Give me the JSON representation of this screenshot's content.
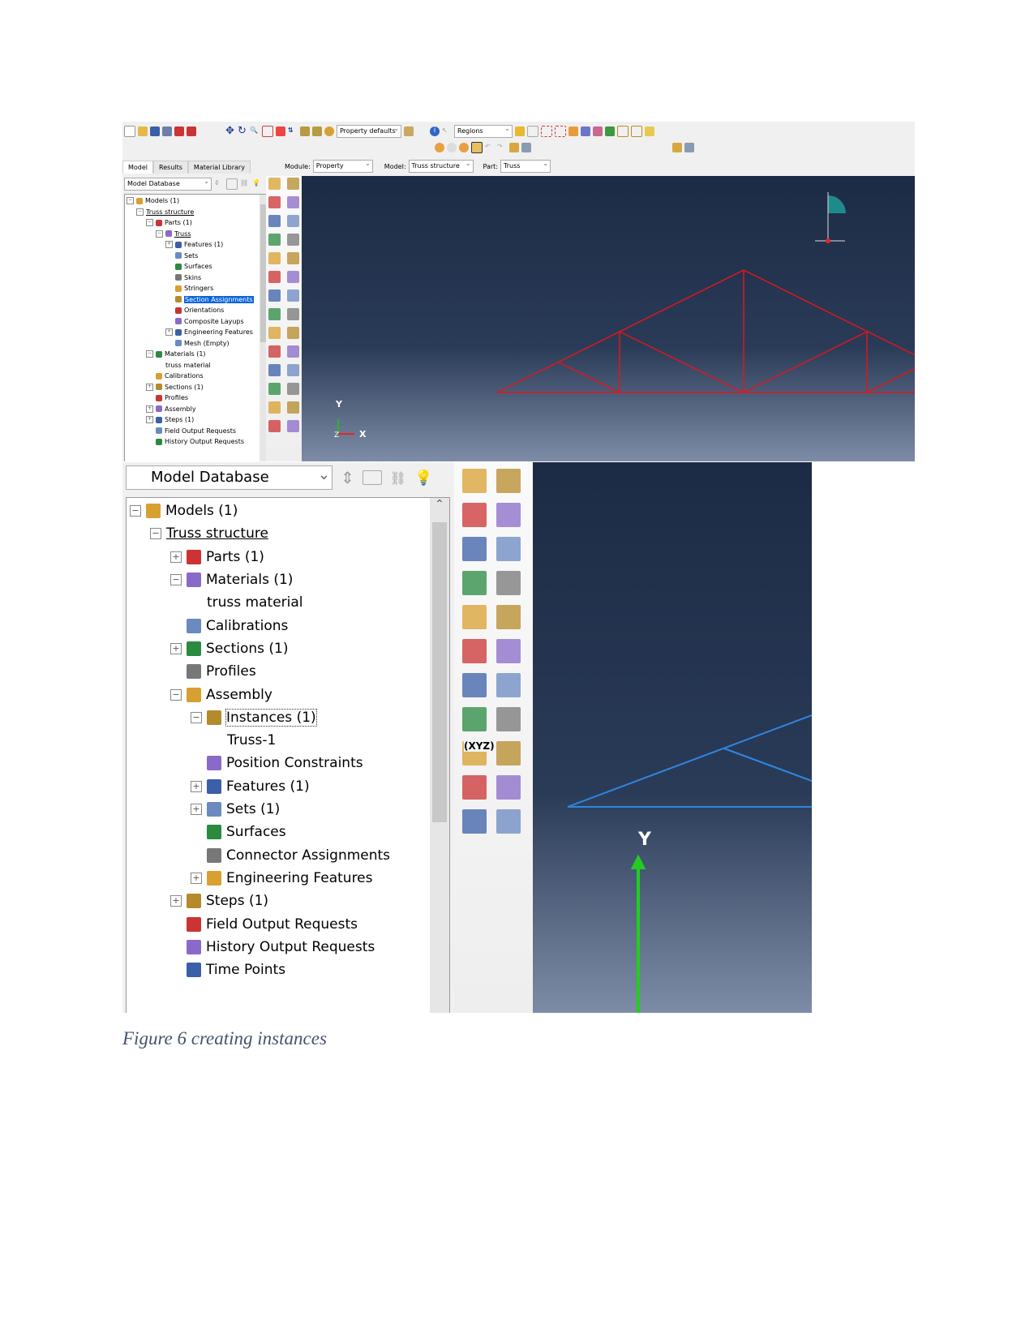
{
  "screenshot1": {
    "toolbar": {
      "render_style": "Property defaults",
      "selection_filter": "Regions"
    },
    "context": {
      "module_label": "Module:",
      "module": "Property",
      "model_label": "Model:",
      "model": "Truss structure",
      "part_label": "Part:",
      "part": "Truss"
    },
    "tabs": [
      "Model",
      "Results",
      "Material Library"
    ],
    "tree_selector": "Model Database",
    "tree": [
      {
        "label": "Models (1)",
        "level": 0,
        "exp": "−"
      },
      {
        "label": "Truss structure",
        "level": 1,
        "exp": "−",
        "style": "ul"
      },
      {
        "label": "Parts (1)",
        "level": 2,
        "exp": "−"
      },
      {
        "label": "Truss",
        "level": 3,
        "exp": "−",
        "style": "ul"
      },
      {
        "label": "Features (1)",
        "level": 4,
        "exp": "+"
      },
      {
        "label": "Sets",
        "level": 4
      },
      {
        "label": "Surfaces",
        "level": 4
      },
      {
        "label": "Skins",
        "level": 4
      },
      {
        "label": "Stringers",
        "level": 4
      },
      {
        "label": "Section Assignments",
        "level": 4,
        "style": "hl"
      },
      {
        "label": "Orientations",
        "level": 4
      },
      {
        "label": "Composite Layups",
        "level": 4
      },
      {
        "label": "Engineering Features",
        "level": 4,
        "exp": "+"
      },
      {
        "label": "Mesh (Empty)",
        "level": 4
      },
      {
        "label": "Materials (1)",
        "level": 2,
        "exp": "−"
      },
      {
        "label": "truss material",
        "level": 3
      },
      {
        "label": "Calibrations",
        "level": 2
      },
      {
        "label": "Sections (1)",
        "level": 2,
        "exp": "+"
      },
      {
        "label": "Profiles",
        "level": 2
      },
      {
        "label": "Assembly",
        "level": 2,
        "exp": "+"
      },
      {
        "label": "Steps (1)",
        "level": 2,
        "exp": "+"
      },
      {
        "label": "Field Output Requests",
        "level": 2
      },
      {
        "label": "History Output Requests",
        "level": 2
      }
    ],
    "triad": {
      "x": "X",
      "y": "Y",
      "z": "Z"
    },
    "mesh_color": "#e0161b"
  },
  "screenshot2": {
    "tree_selector": "Model Database",
    "tree": [
      {
        "label": "Models (1)",
        "level": 0,
        "exp": "−"
      },
      {
        "label": "Truss structure",
        "level": 1,
        "exp": "−",
        "style": "ul"
      },
      {
        "label": "Parts (1)",
        "level": 2,
        "exp": "+"
      },
      {
        "label": "Materials (1)",
        "level": 2,
        "exp": "−"
      },
      {
        "label": "truss material",
        "level": 3
      },
      {
        "label": "Calibrations",
        "level": 2
      },
      {
        "label": "Sections (1)",
        "level": 2,
        "exp": "+"
      },
      {
        "label": "Profiles",
        "level": 2
      },
      {
        "label": "Assembly",
        "level": 2,
        "exp": "−"
      },
      {
        "label": "Instances (1)",
        "level": 3,
        "exp": "−",
        "style": "dash"
      },
      {
        "label": "Truss-1",
        "level": 4
      },
      {
        "label": "Position Constraints",
        "level": 3
      },
      {
        "label": "Features (1)",
        "level": 3,
        "exp": "+"
      },
      {
        "label": "Sets (1)",
        "level": 3,
        "exp": "+"
      },
      {
        "label": "Surfaces",
        "level": 3
      },
      {
        "label": "Connector Assignments",
        "level": 3
      },
      {
        "label": "Engineering Features",
        "level": 3,
        "exp": "+"
      },
      {
        "label": "Steps (1)",
        "level": 2,
        "exp": "+"
      },
      {
        "label": "Field Output Requests",
        "level": 2
      },
      {
        "label": "History Output Requests",
        "level": 2
      },
      {
        "label": "Time Points",
        "level": 2
      }
    ],
    "toolbox_label": "(XYZ)",
    "triad": {
      "y": "Y"
    },
    "mesh_color": "#2f86e0"
  },
  "caption": "Figure 6 creating instances"
}
